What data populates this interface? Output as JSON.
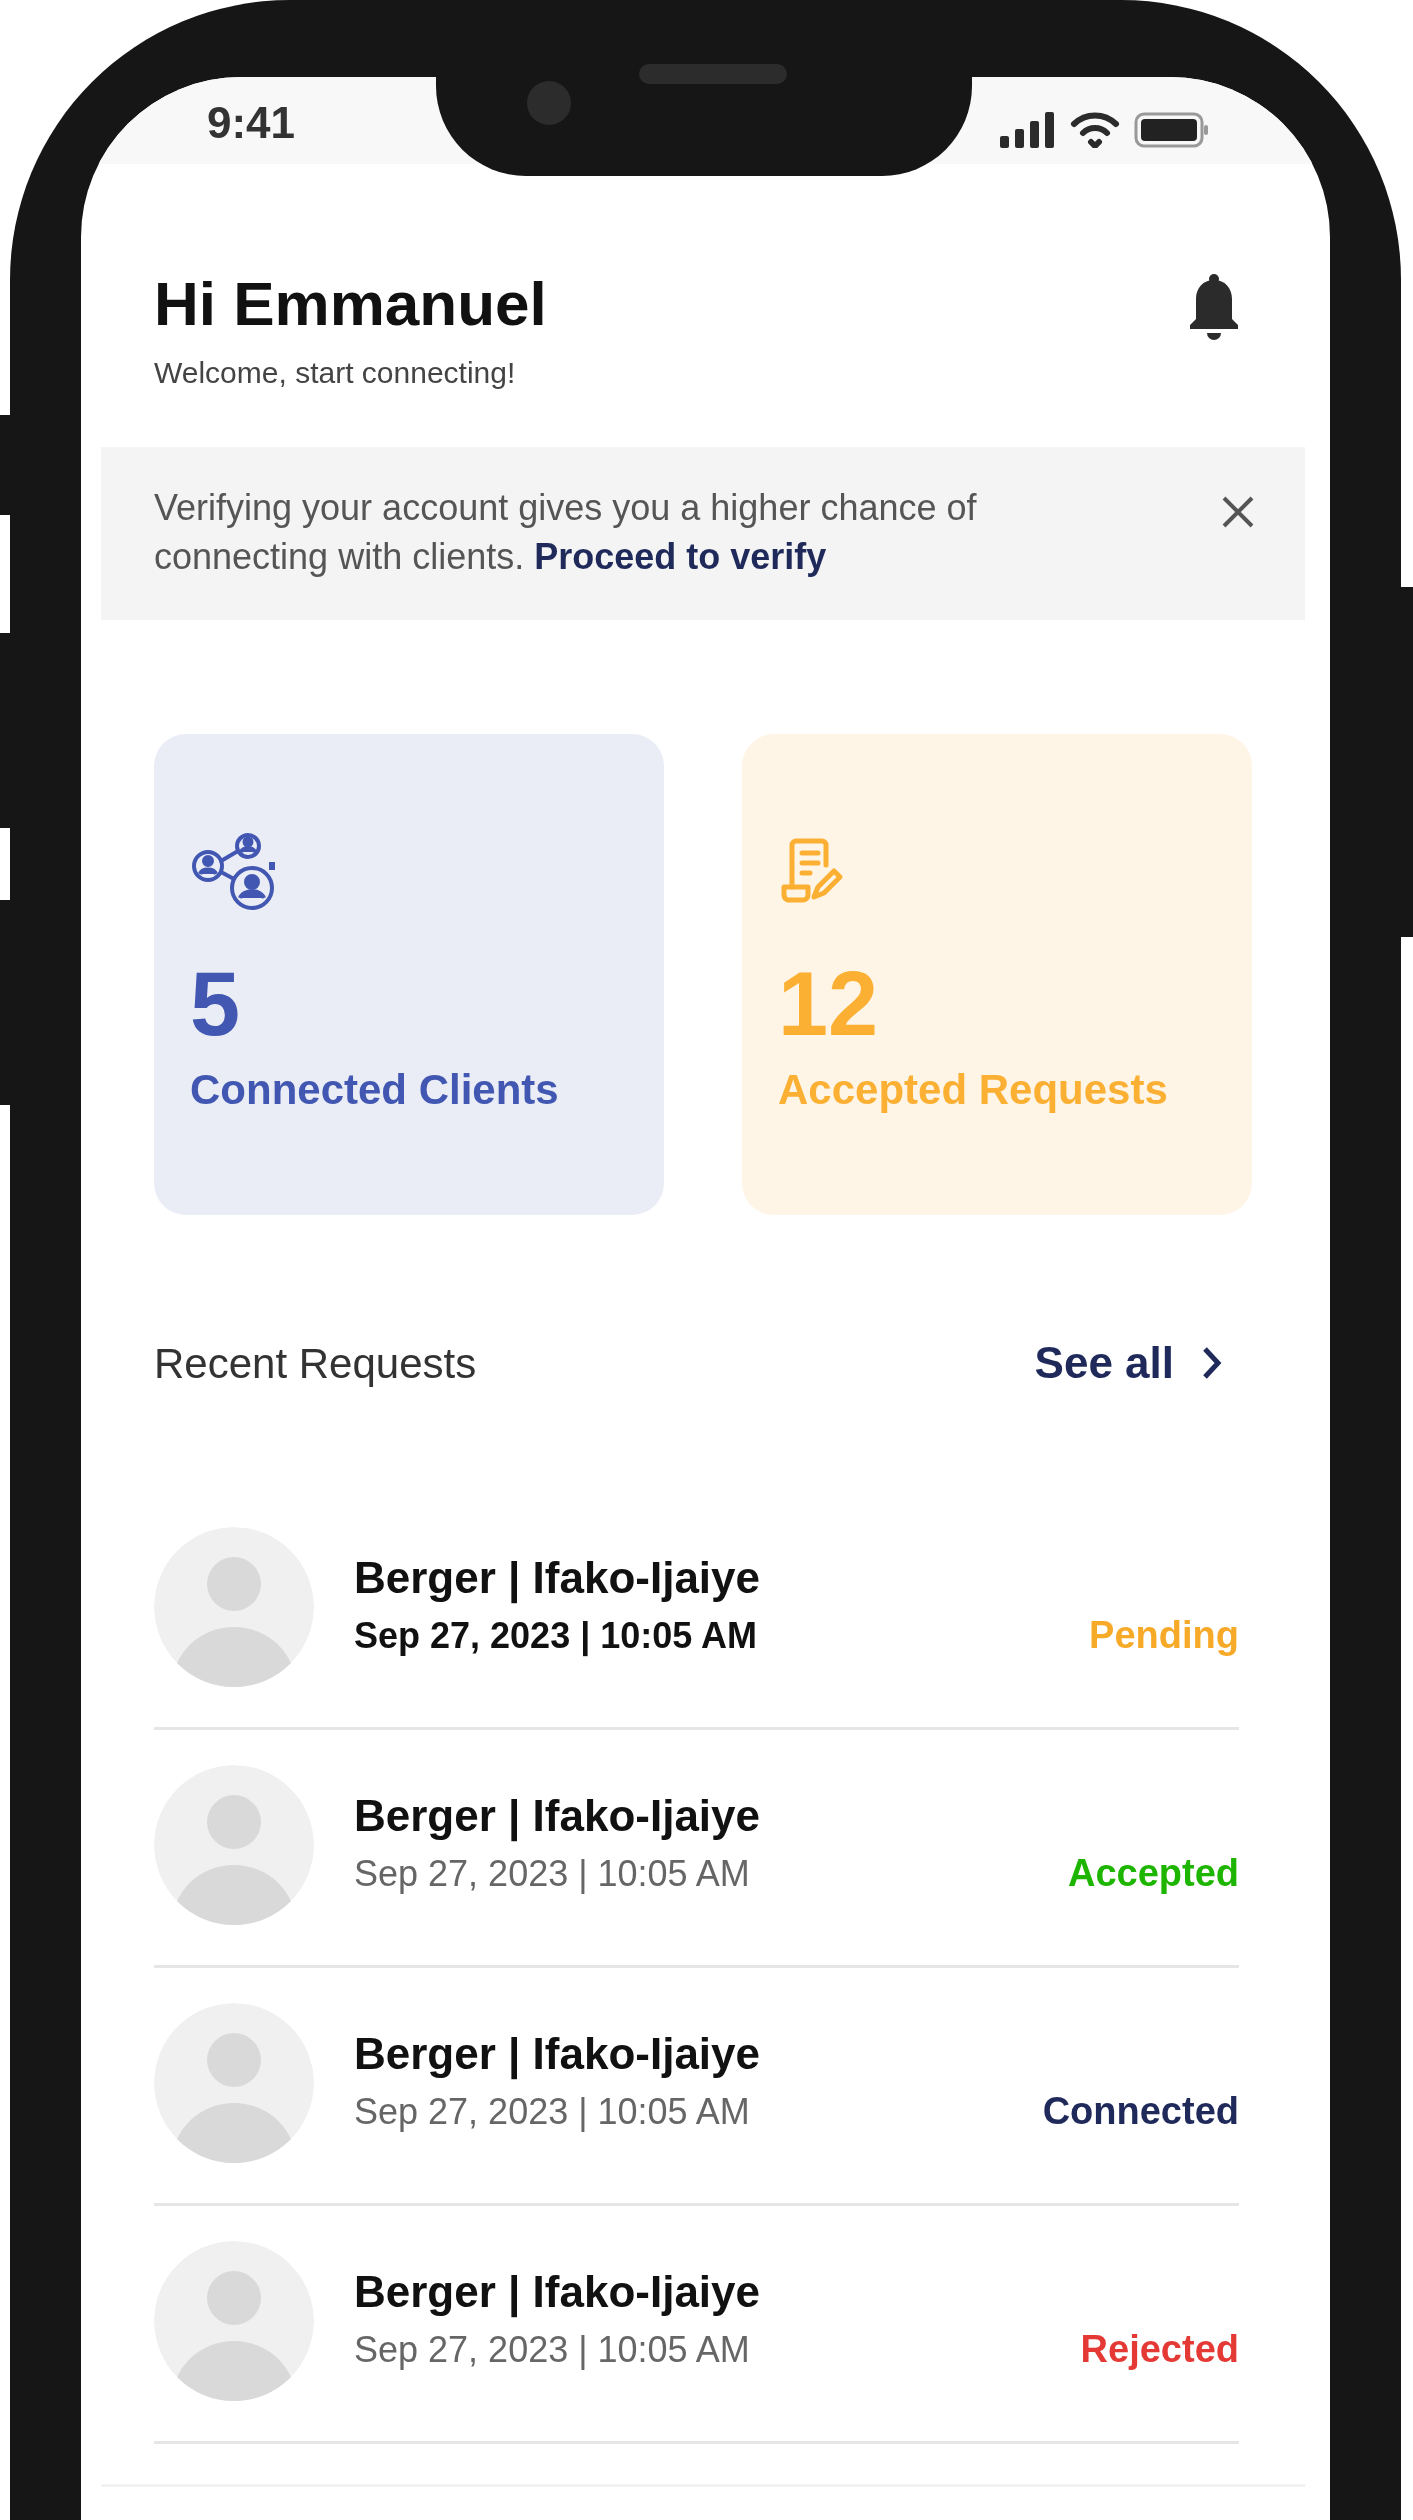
{
  "status_bar": {
    "time": "9:41"
  },
  "header": {
    "greeting": "Hi Emmanuel",
    "subtitle": "Welcome, start connecting!"
  },
  "banner": {
    "text": "Verifying your account gives you a higher chance of connecting with clients.",
    "link": "Proceed to verify"
  },
  "stats": [
    {
      "kind": "clients",
      "value": "5",
      "label": "Connected Clients"
    },
    {
      "kind": "requests",
      "value": "12",
      "label": "Accepted Requests"
    }
  ],
  "recent": {
    "title": "Recent Requests",
    "see_all": "See all"
  },
  "requests": [
    {
      "name": "Berger | Ifako-Ijaiye",
      "date": "Sep 27, 2023 | 10:05 AM",
      "status": "Pending",
      "color": "#f7a928",
      "unread": true
    },
    {
      "name": "Berger | Ifako-Ijaiye",
      "date": "Sep 27, 2023 | 10:05 AM",
      "status": "Accepted",
      "color": "#1db500",
      "unread": false
    },
    {
      "name": "Berger | Ifako-Ijaiye",
      "date": "Sep 27, 2023 | 10:05 AM",
      "status": "Connected",
      "color": "#1f2a5a",
      "unread": false
    },
    {
      "name": "Berger | Ifako-Ijaiye",
      "date": "Sep 27, 2023 | 10:05 AM",
      "status": "Rejected",
      "color": "#e53935",
      "unread": false
    }
  ]
}
